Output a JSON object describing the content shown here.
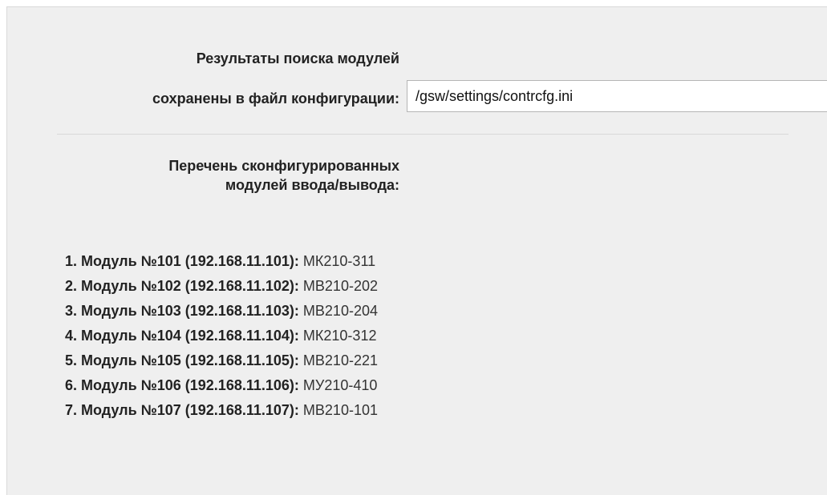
{
  "config": {
    "label_line1": "Результаты поиска модулей",
    "label_line2": "сохранены в файл конфигурации:",
    "file_path": "/gsw/settings/contrcfg.ini"
  },
  "modules_section": {
    "title_line1": "Перечень сконфигурированных",
    "title_line2": "модулей ввода/вывода:",
    "items": [
      {
        "key": "1. Модуль №101 (192.168.11.101):",
        "value": "МК210-311"
      },
      {
        "key": "2. Модуль №102 (192.168.11.102):",
        "value": "МВ210-202"
      },
      {
        "key": "3. Модуль №103 (192.168.11.103):",
        "value": "МВ210-204"
      },
      {
        "key": "4. Модуль №104 (192.168.11.104):",
        "value": "МК210-312"
      },
      {
        "key": "5. Модуль №105 (192.168.11.105):",
        "value": "МВ210-221"
      },
      {
        "key": "6. Модуль №106 (192.168.11.106):",
        "value": "МУ210-410"
      },
      {
        "key": "7. Модуль №107 (192.168.11.107):",
        "value": "МВ210-101"
      }
    ]
  },
  "colors": {
    "panel_background": "#efefef",
    "input_background": "#ffffff",
    "input_border": "#b5b5b5"
  }
}
